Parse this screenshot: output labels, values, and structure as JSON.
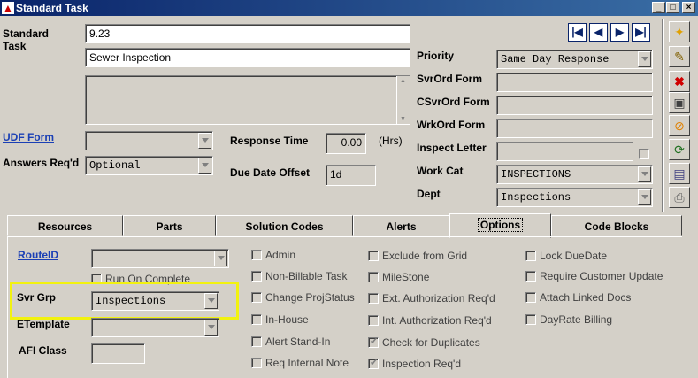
{
  "window": {
    "title": "Standard Task"
  },
  "labels": {
    "standard_task": "Standard\nTask",
    "udf_form": "UDF Form",
    "answers_req": "Answers Req'd",
    "response_time": "Response Time",
    "hrs": "(Hrs)",
    "due_date_offset": "Due Date Offset",
    "priority": "Priority",
    "svrord_form": "SvrOrd Form",
    "csvrord_form": "CSvrOrd Form",
    "wrkord_form": "WrkOrd Form",
    "inspect_letter": "Inspect Letter",
    "work_cat": "Work Cat",
    "dept": "Dept"
  },
  "fields": {
    "task_code": "9.23",
    "task_name": "Sewer Inspection",
    "answers_req": "Optional",
    "response_time": "0.00",
    "due_date_offset": "1d",
    "priority": "Same Day Response",
    "work_cat": "INSPECTIONS",
    "dept": "Inspections"
  },
  "tabs": [
    "Resources",
    "Parts",
    "Solution Codes",
    "Alerts",
    "Options",
    "Code Blocks"
  ],
  "active_tab": "Options",
  "options": {
    "route_id": "RouteID",
    "run_on_complete": "Run On Complete",
    "svr_grp_label": "Svr Grp",
    "svr_grp_value": "Inspections",
    "etemplate": "ETemplate",
    "afi_class": "AFI Class",
    "col1": [
      "Admin",
      "Non-Billable Task",
      "Change ProjStatus",
      "In-House",
      "Alert Stand-In",
      "Req Internal Note"
    ],
    "col2": [
      "Exclude from Grid",
      "MileStone",
      "Ext. Authorization Req'd",
      "Int.  Authorization Req'd",
      "Check for Duplicates",
      "Inspection Req'd"
    ],
    "col3": [
      "Lock DueDate",
      "Require Customer Update",
      "Attach Linked Docs",
      "DayRate Billing"
    ]
  },
  "icons": {
    "window": "app-icon",
    "nav": [
      "first-record-icon",
      "prev-record-icon",
      "next-record-icon",
      "last-record-icon"
    ],
    "toolbar": [
      "new-icon",
      "edit-icon",
      "delete-icon",
      "save-icon",
      "cancel-icon",
      "refresh-icon",
      "picture-icon",
      "print-icon"
    ]
  },
  "colors": {
    "highlight": "#f2f20f",
    "link": "#1a3fb5",
    "titlebar": "#0a246a"
  }
}
